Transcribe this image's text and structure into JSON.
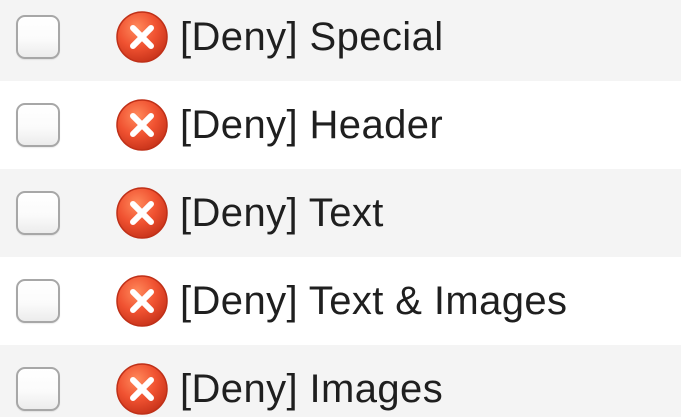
{
  "permissions": {
    "items": [
      {
        "label": "[Deny] Special",
        "checked": false,
        "status_icon": "deny-x-icon"
      },
      {
        "label": "[Deny] Header",
        "checked": false,
        "status_icon": "deny-x-icon"
      },
      {
        "label": "[Deny] Text",
        "checked": false,
        "status_icon": "deny-x-icon"
      },
      {
        "label": "[Deny] Text & Images",
        "checked": false,
        "status_icon": "deny-x-icon"
      },
      {
        "label": "[Deny] Images",
        "checked": false,
        "status_icon": "deny-x-icon"
      }
    ]
  },
  "colors": {
    "deny_icon": "#e8462a",
    "row_alt": "#f4f4f4",
    "text": "#1f1f1f"
  }
}
